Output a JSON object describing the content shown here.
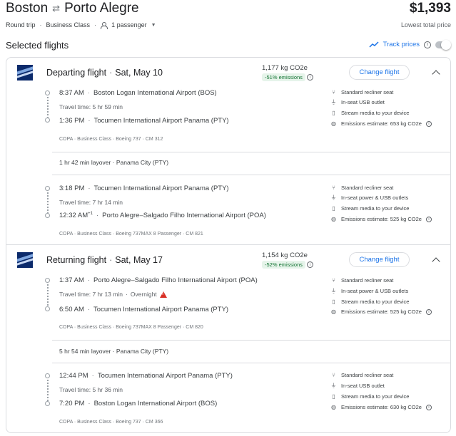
{
  "header": {
    "origin": "Boston",
    "destination": "Porto Alegre",
    "price": "$1,393",
    "price_note": "Lowest total price",
    "trip_type": "Round trip",
    "cabin": "Business Class",
    "passengers": "1 passenger"
  },
  "section_title": "Selected flights",
  "track_prices": {
    "label": "Track prices",
    "enabled": false
  },
  "departing": {
    "title": "Departing flight",
    "date": "Sat, May 10",
    "co2": "1,177 kg CO2e",
    "co2_badge": "-51% emissions",
    "change_label": "Change flight",
    "legs": [
      {
        "dep_time": "8:37 AM",
        "dep_airport": "Boston Logan International Airport (BOS)",
        "travel_time": "Travel time: 5 hr 59 min",
        "arr_time": "1:36 PM",
        "arr_airport": "Tocumen International Airport Panama (PTY)",
        "meta": "COPA · Business Class · Boeing 737 · CM 312",
        "amenities": [
          "Standard recliner seat",
          "In-seat USB outlet",
          "Stream media to your device",
          "Emissions estimate: 653 kg CO2e"
        ]
      },
      {
        "dep_time": "3:18 PM",
        "dep_airport": "Tocumen International Airport Panama (PTY)",
        "travel_time": "Travel time: 7 hr 14 min",
        "arr_time": "12:32 AM",
        "arr_sup": "+1",
        "arr_airport": "Porto Alegre–Salgado Filho International Airport (POA)",
        "meta": "COPA · Business Class · Boeing 737MAX 8 Passenger · CM 821",
        "amenities": [
          "Standard recliner seat",
          "In-seat power & USB outlets",
          "Stream media to your device",
          "Emissions estimate: 525 kg CO2e"
        ]
      }
    ],
    "layover": "1 hr 42 min layover · Panama City (PTY)"
  },
  "returning": {
    "title": "Returning flight",
    "date": "Sat, May 17",
    "co2": "1,154 kg CO2e",
    "co2_badge": "-52% emissions",
    "change_label": "Change flight",
    "legs": [
      {
        "dep_time": "1:37 AM",
        "dep_airport": "Porto Alegre–Salgado Filho International Airport (POA)",
        "travel_time": "Travel time: 7 hr 13 min",
        "overnight": "Overnight",
        "arr_time": "6:50 AM",
        "arr_airport": "Tocumen International Airport Panama (PTY)",
        "meta": "COPA · Business Class · Boeing 737MAX 8 Passenger · CM 820",
        "amenities": [
          "Standard recliner seat",
          "In-seat power & USB outlets",
          "Stream media to your device",
          "Emissions estimate: 525 kg CO2e"
        ]
      },
      {
        "dep_time": "12:44 PM",
        "dep_airport": "Tocumen International Airport Panama (PTY)",
        "travel_time": "Travel time: 5 hr 36 min",
        "arr_time": "7:20 PM",
        "arr_airport": "Boston Logan International Airport (BOS)",
        "meta": "COPA · Business Class · Boeing 737 · CM 366",
        "amenities": [
          "Standard recliner seat",
          "In-seat USB outlet",
          "Stream media to your device",
          "Emissions estimate: 630 kg CO2e"
        ]
      }
    ],
    "layover": "5 hr 54 min layover · Panama City (PTY)"
  },
  "icons": {
    "seat": "seat-icon",
    "outlet": "power-outlet-icon",
    "media": "phone-media-icon",
    "emissions": "globe-icon"
  },
  "colors": {
    "accent": "#1a73e8",
    "badge_bg": "#e6f4ea",
    "badge_text": "#137333",
    "warning": "#d93025"
  }
}
